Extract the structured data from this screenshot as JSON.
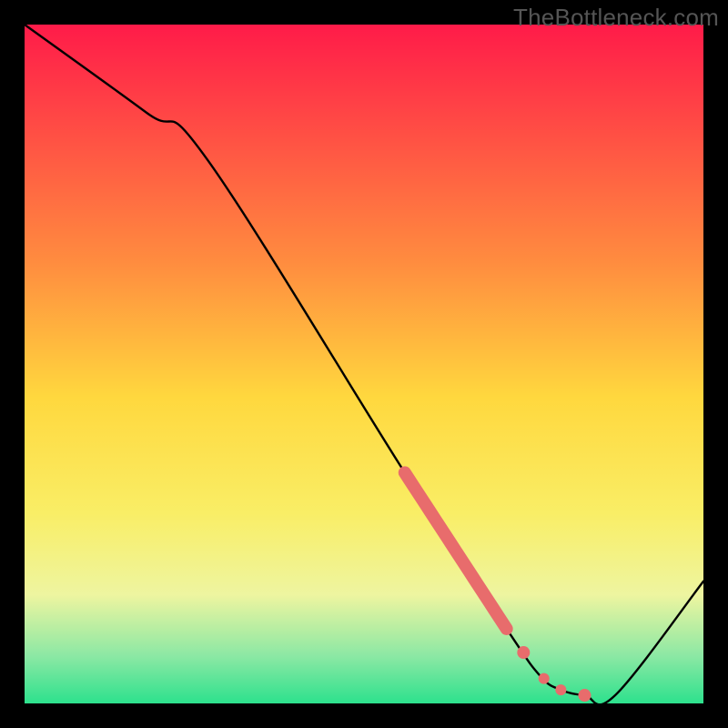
{
  "watermark": "TheBottleneck.com",
  "chart_data": {
    "type": "line",
    "title": "",
    "xlabel": "",
    "ylabel": "",
    "xlim": [
      0,
      100
    ],
    "ylim": [
      0,
      100
    ],
    "gradient_stops": [
      {
        "offset": 0,
        "color": "#ff1b49"
      },
      {
        "offset": 35,
        "color": "#ff8c3f"
      },
      {
        "offset": 55,
        "color": "#ffd83e"
      },
      {
        "offset": 72,
        "color": "#f9ee66"
      },
      {
        "offset": 84,
        "color": "#eef5a0"
      },
      {
        "offset": 93,
        "color": "#8ce8a4"
      },
      {
        "offset": 100,
        "color": "#2de18d"
      }
    ],
    "series": [
      {
        "name": "bottleneck-curve",
        "x": [
          0,
          18,
          27,
          56,
          71,
          76,
          79,
          82.5,
          87,
          100
        ],
        "values": [
          100,
          87,
          80,
          34,
          11,
          4,
          2,
          1.2,
          1.2,
          18
        ]
      }
    ],
    "highlight_segment": {
      "x_start": 56,
      "x_end": 71
    },
    "highlight_points_x": [
      73.5,
      76.5,
      79,
      82.5
    ],
    "highlight_color": "#e86c6c"
  }
}
